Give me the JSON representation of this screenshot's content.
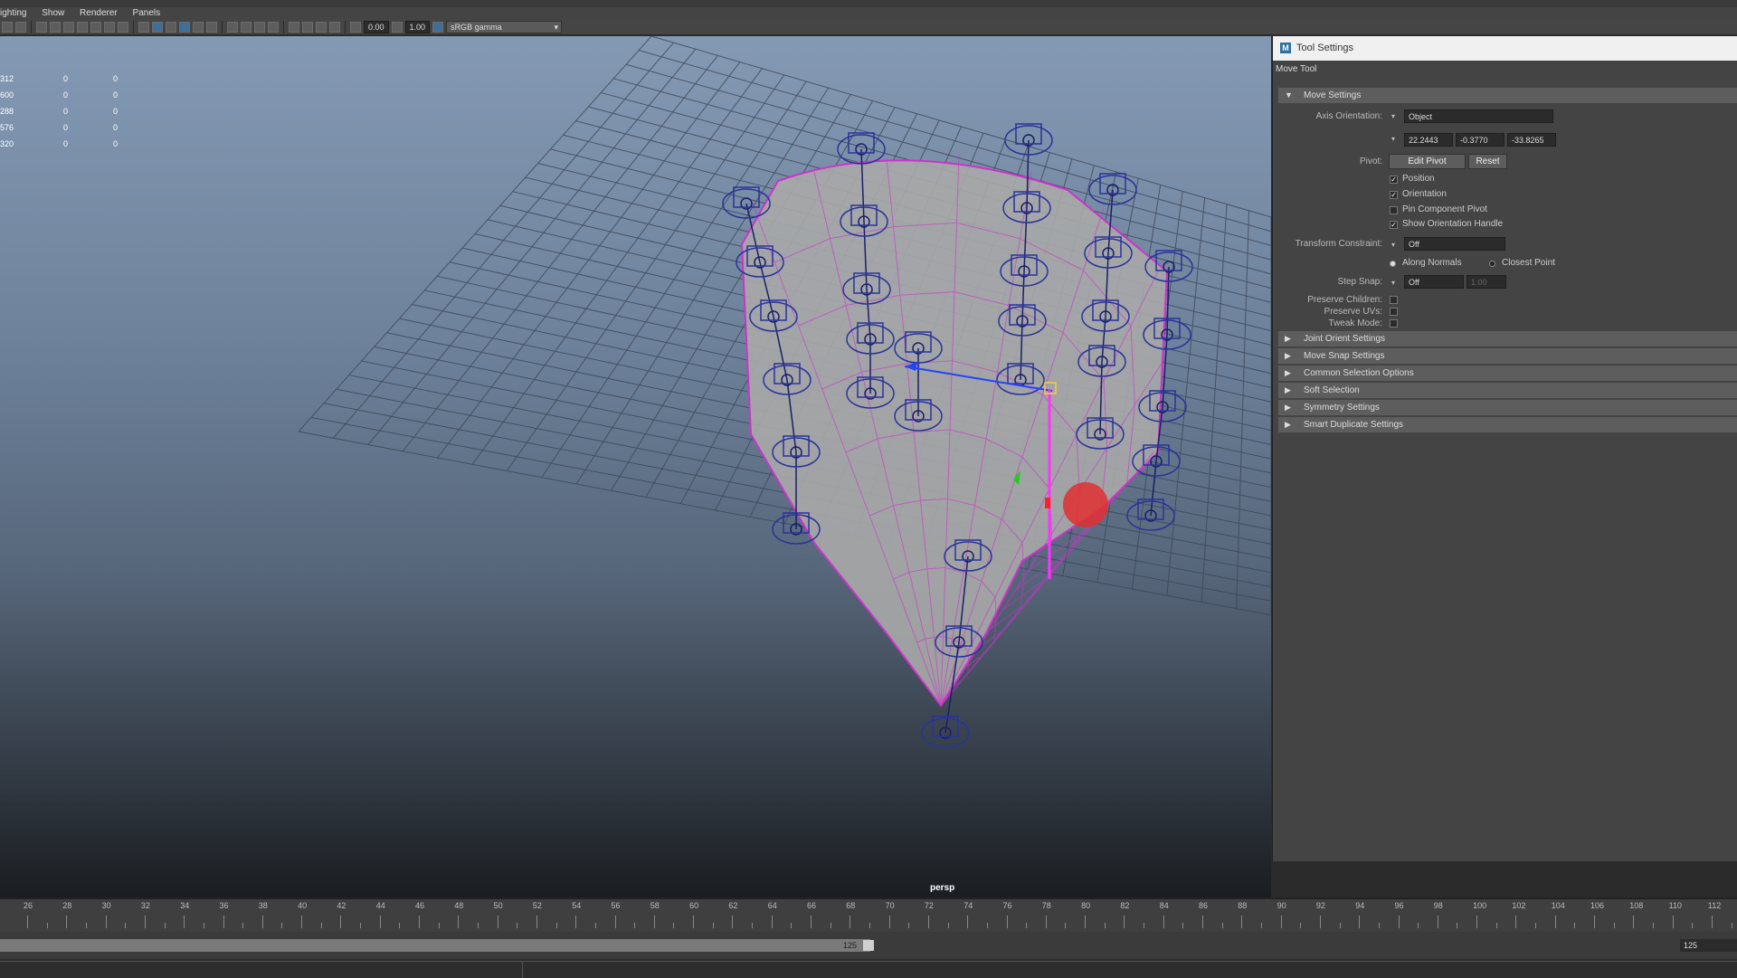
{
  "menu": [
    "ighting",
    "Show",
    "Renderer",
    "Panels"
  ],
  "toolbar": {
    "exposure": "0.00",
    "gamma": "1.00",
    "color_space": "sRGB gamma"
  },
  "hud": [
    [
      "312",
      "0",
      "0"
    ],
    [
      "600",
      "0",
      "0"
    ],
    [
      "288",
      "0",
      "0"
    ],
    [
      "576",
      "0",
      "0"
    ],
    [
      "320",
      "0",
      "0"
    ]
  ],
  "viewport_label": "persp",
  "tool_settings": {
    "window_title": "Tool Settings",
    "tool_name": "Move Tool",
    "move_settings": {
      "header": "Move Settings",
      "axis_orientation_label": "Axis Orientation:",
      "axis_orientation_value": "Object",
      "vec_x": "22.2443",
      "vec_y": "-0.3770",
      "vec_z": "-33.8265",
      "pivot_label": "Pivot:",
      "edit_pivot": "Edit Pivot",
      "reset": "Reset",
      "position": "Position",
      "orientation": "Orientation",
      "pin_component_pivot": "Pin Component Pivot",
      "show_orientation_handle": "Show Orientation Handle",
      "transform_constraint_label": "Transform Constraint:",
      "transform_constraint_value": "Off",
      "along_normals": "Along Normals",
      "closest_point": "Closest Point",
      "step_snap_label": "Step Snap:",
      "step_snap_value": "Off",
      "step_snap_amount": "1.00",
      "preserve_children": "Preserve Children:",
      "preserve_uvs": "Preserve UVs:",
      "tweak_mode": "Tweak Mode:"
    },
    "sections": [
      "Joint Orient Settings",
      "Move Snap Settings",
      "Common Selection Options",
      "Soft Selection",
      "Symmetry Settings",
      "Smart Duplicate Settings"
    ]
  },
  "timeline": {
    "ticks": [
      "26",
      "28",
      "30",
      "32",
      "34",
      "36",
      "38",
      "40",
      "42",
      "44",
      "46",
      "48",
      "50",
      "52",
      "54",
      "56",
      "58",
      "60",
      "62",
      "64",
      "66",
      "68",
      "70",
      "72",
      "74",
      "76",
      "78",
      "80",
      "82",
      "84",
      "86",
      "88",
      "90",
      "92",
      "94",
      "96",
      "98",
      "100",
      "102",
      "104",
      "106",
      "108",
      "110",
      "112"
    ],
    "range_current": "125",
    "range_end": "125"
  }
}
